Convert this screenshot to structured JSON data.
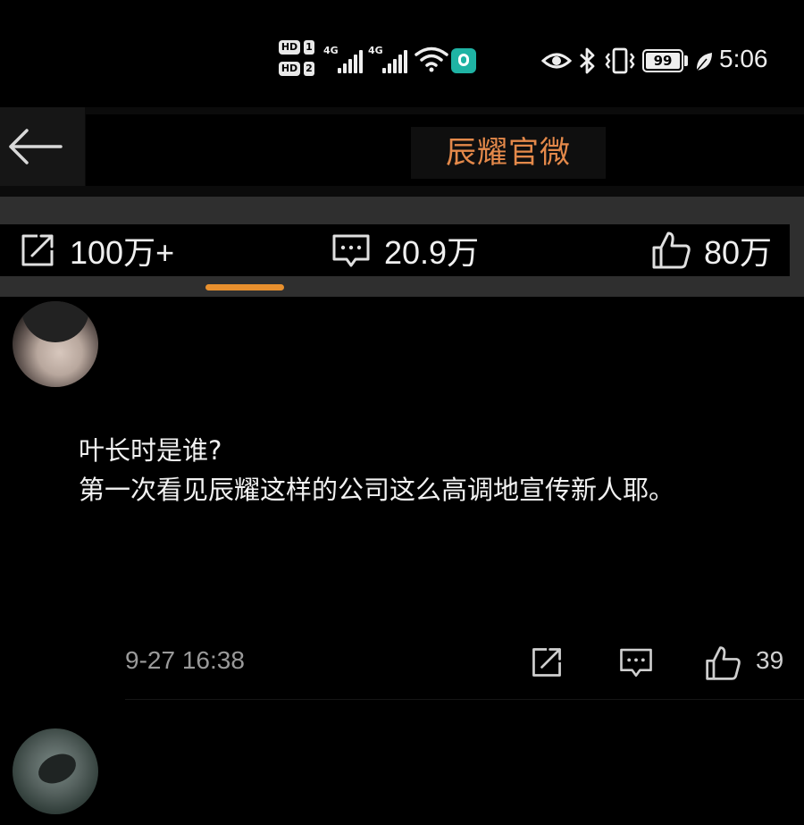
{
  "status_bar": {
    "hd1": "HD",
    "hd1_num": "1",
    "hd2": "HD",
    "hd2_num": "2",
    "net1": "4G",
    "net2": "4G",
    "battery": "99",
    "time": "5:06",
    "icons": [
      "signal-icon",
      "wifi-icon",
      "app-notification-icon",
      "eye-icon",
      "bluetooth-icon",
      "vibrate-icon",
      "battery-icon",
      "leaf-icon"
    ]
  },
  "header": {
    "back_icon": "back-arrow-icon",
    "title": "辰耀官微",
    "title_color": "#e4894a"
  },
  "stats": {
    "repost_icon": "share-icon",
    "repost": "100万+",
    "comment_icon": "comment-icon",
    "comments": "20.9万",
    "like_icon": "thumbs-up-icon",
    "likes": "80万",
    "indicator_color": "#e8902e"
  },
  "comment": {
    "text": "叶长时是谁?\n第一次看见辰耀这样的公司这么高调地宣传新人耶。",
    "timestamp": "9-27 16:38",
    "like_count": "39"
  }
}
